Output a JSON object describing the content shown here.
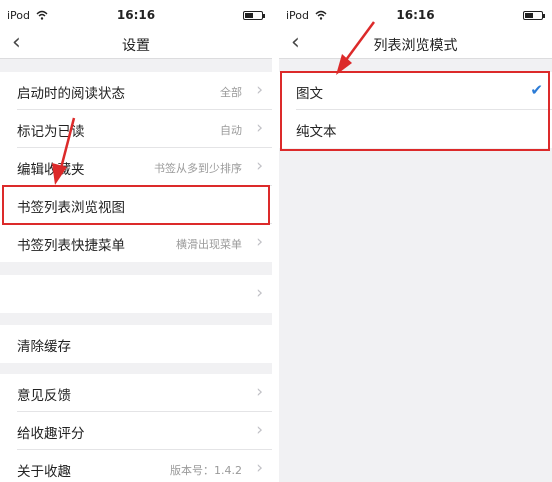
{
  "status_bar": {
    "carrier": "iPod",
    "time": "16:16"
  },
  "left": {
    "title": "设置",
    "rows": [
      {
        "label": "启动时的阅读状态",
        "value": "全部"
      },
      {
        "label": "标记为已读",
        "value": "自动"
      },
      {
        "label": "编辑收藏夹",
        "value": "书签从多到少排序"
      },
      {
        "label": "书签列表浏览视图",
        "value": ""
      },
      {
        "label": "书签列表快捷菜单",
        "value": "横滑出现菜单"
      },
      {
        "label": "",
        "value": ""
      },
      {
        "label": "清除缓存",
        "value": ""
      },
      {
        "label": "意见反馈",
        "value": ""
      },
      {
        "label": "给收趣评分",
        "value": ""
      },
      {
        "label": "关于收趣",
        "value": "版本号：1.4.2"
      }
    ]
  },
  "right": {
    "title": "列表浏览模式",
    "options": [
      {
        "label": "图文",
        "selected": true
      },
      {
        "label": "纯文本",
        "selected": false
      }
    ]
  },
  "colors": {
    "highlight": "#dc2a2a",
    "check": "#2b7bd6"
  }
}
